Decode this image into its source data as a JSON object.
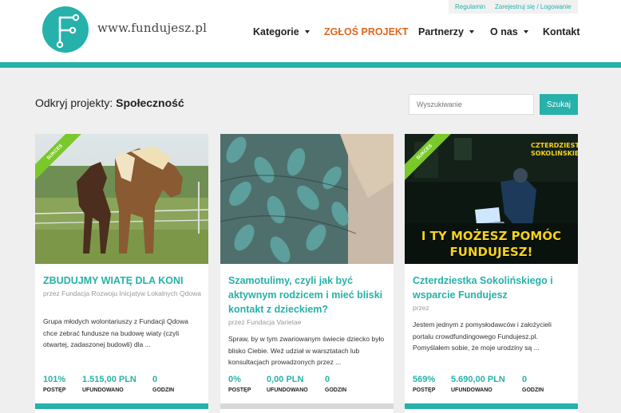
{
  "site": {
    "logo_text": "www.fundujesz.pl",
    "accent_color": "#26b1aa",
    "highlight_color": "#e0661e"
  },
  "top_links": {
    "regulamin": "Regulamin",
    "login": "Zarejestruj się / Logowanie"
  },
  "nav": {
    "kategorie": "Kategorie",
    "zglos": "ZGŁOŚ PROJEKT",
    "partnerzy": "Partnerzy",
    "onas": "O nas",
    "kontakt": "Kontakt"
  },
  "page": {
    "title_prefix": "Odkryj projekty:",
    "title_category": "Społeczność"
  },
  "search": {
    "placeholder": "Wyszukiwanie",
    "button": "Szukaj"
  },
  "stat_labels": {
    "progress": "POSTĘP",
    "funded": "UFUNDOWANO",
    "hours": "GODZIN"
  },
  "projects": [
    {
      "ribbon": "SUKCES",
      "image_icon": "horses-photo",
      "title": "ZBUDUJMY WIATĘ DLA KONI",
      "author": "przez Fundacja Rozwoju Inicjatyw Lokalnych Qdowa",
      "description": "Grupa młodych wolontariuszy z Fundacji Qdowa chce zebrać fundusze na budowę wiaty (czyli otwartej, zadaszonej budowli) dla ...",
      "progress": "101%",
      "funded": "1.515,00 PLN",
      "hours": "0",
      "progress_fraction": 1.0
    },
    {
      "ribbon": "",
      "image_icon": "baby-carrier-photo",
      "title": "Szamotulimy, czyli jak być aktywnym rodzicem i mieć bliski kontakt z dzieckiem?",
      "author": "przez Fundacja Varietae",
      "description": "Spraw, by w tym zwariowanym świecie dziecko było blisko Ciebie. Weź udział w warsztatach lub konsultacjach prowadzonych przez ...",
      "progress": "0%",
      "funded": "0,00 PLN",
      "hours": "0",
      "progress_fraction": 0.0
    },
    {
      "ribbon": "SUKCES",
      "image_icon": "laptop-night-photo",
      "image_caption_top": "CZTERDZIESTKA SOKOLIŃSKIEGO",
      "image_caption_main": "I TY MOŻESZ POMÓC FUNDUJESZ!",
      "title": "Czterdziestka Sokolińskiego i wsparcie Fundujesz",
      "author": "przez",
      "description": "Jestem jednym z pomysłodawców i założycieli portalu crowdfundingowego Fundujesz.pl. Pomyślałem sobie, że moje urodziny są ...",
      "progress": "569%",
      "funded": "5.690,00 PLN",
      "hours": "0",
      "progress_fraction": 1.0
    }
  ]
}
